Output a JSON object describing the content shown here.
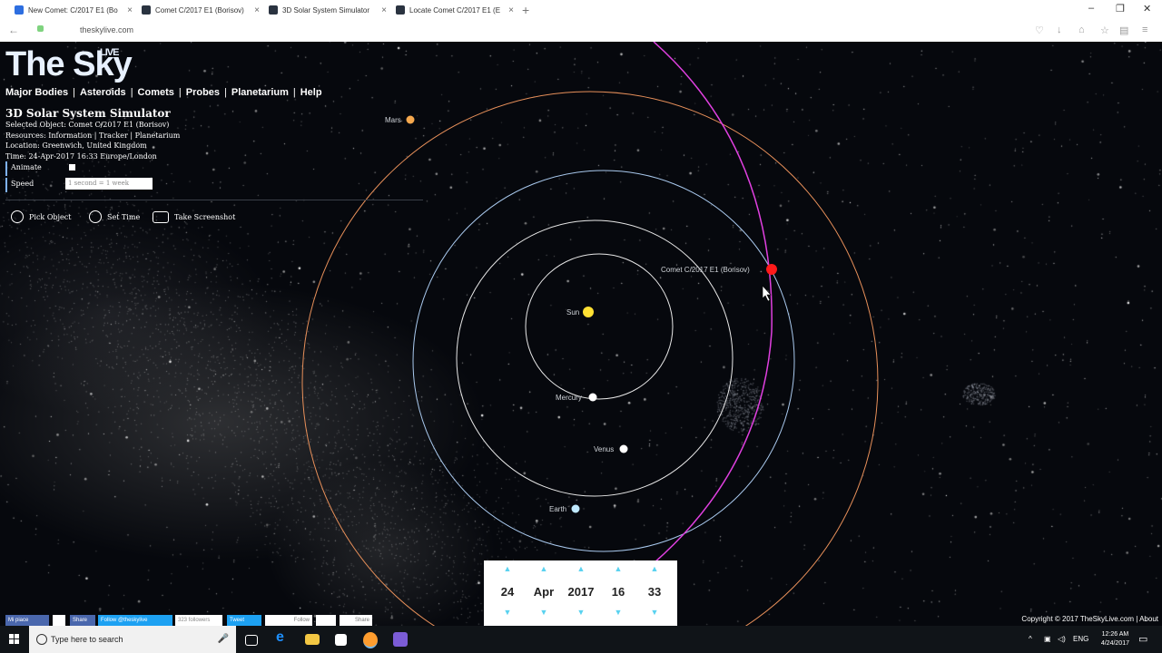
{
  "browser": {
    "tabs": [
      {
        "title": "New Comet: C/2017 E1 (Bo",
        "favicon": "s"
      },
      {
        "title": "Comet C/2017 E1 (Borisov)",
        "favicon": "sky"
      },
      {
        "title": "3D Solar System Simulator",
        "favicon": "sky"
      },
      {
        "title": "Locate Comet C/2017 E1 (E",
        "favicon": "sky"
      }
    ],
    "url": "theskylive.com"
  },
  "site": {
    "logo": "The Sky",
    "logo_badge": "LIVE",
    "nav": [
      "Major Bodies",
      "Asteroids",
      "Comets",
      "Probes",
      "Planetarium",
      "Help"
    ],
    "nav_separator": "|"
  },
  "panel": {
    "title": "3D Solar System Simulator",
    "selected_object": "Selected Object: Comet C/2017 E1 (Borisov)",
    "resources": "Resources: Information | Tracker | Planetarium",
    "location": "Location: Greenwich, United Kingdom",
    "time": "Time: 24-Apr-2017 16:33 Europe/London",
    "animate_label": "Animate",
    "speed_label": "Speed",
    "speed_value": "1 second = 1 week"
  },
  "tools": {
    "pick": "Pick Object",
    "time": "Set Time",
    "screenshot": "Take Screenshot"
  },
  "bodies": {
    "sun": "Sun",
    "mercury": "Mercury",
    "venus": "Venus",
    "earth": "Earth",
    "mars": "Mars",
    "comet": "Comet C/2017 E1 (Borisov)"
  },
  "colors": {
    "sun": "#ffe033",
    "mercury": "#ffffff",
    "venus": "#ffffff",
    "earth": "#bfe9ff",
    "mars": "#f5a84e",
    "comet": "#ff1a1a",
    "comet_orbit": "#e040e0",
    "mars_orbit": "#e8905a",
    "earth_orbit": "#a9c9ee",
    "inner_orbit": "#e8e8e8"
  },
  "date": {
    "day": "24",
    "month": "Apr",
    "year": "2017",
    "hour": "16",
    "minute": "33"
  },
  "social": {
    "fb": "Mi piace",
    "share": "Share",
    "twitter_follow": "Follow @theskylive",
    "followers": "323 followers",
    "tweet": "Tweet",
    "follow": "Follow",
    "share2": "Share"
  },
  "copyright": "Copyright © 2017 TheSkyLive.com | About",
  "taskbar": {
    "search_placeholder": "Type here to search",
    "lang": "ENG",
    "time": "12:26 AM",
    "date": "4/24/2017"
  }
}
